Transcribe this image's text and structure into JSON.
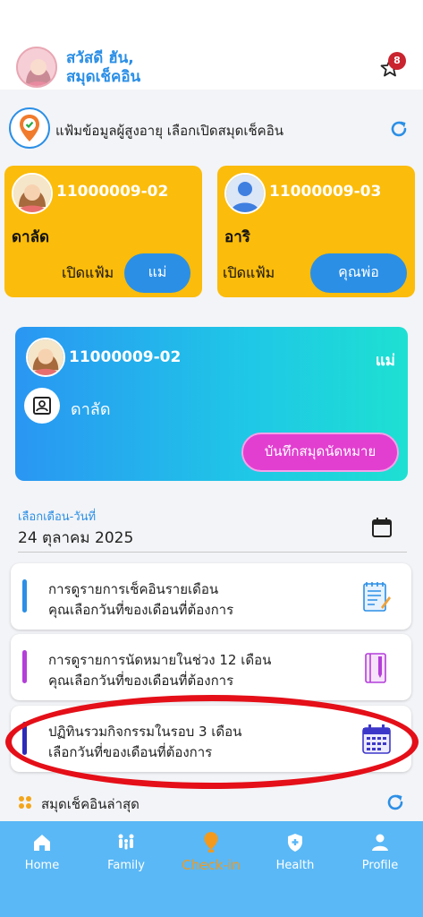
{
  "header": {
    "greeting_line1": "สวัสดี ฮัน,",
    "greeting_line2": "สมุดเช็คอิน",
    "notification_count": "8",
    "avatar_icon": "female-avatar"
  },
  "elderly_section": {
    "title": "แฟ้มข้อมูลผู้สูงอายุ เลือกเปิดสมุดเช็คอิน",
    "location_icon": "location-check-icon",
    "refresh_icon": "refresh-icon"
  },
  "cards": [
    {
      "id": "11000009-02",
      "name": "ดาลัด",
      "open_label": "เปิดแฟ้ม",
      "role": "แม่",
      "avatar": "female-avatar"
    },
    {
      "id": "11000009-03",
      "name": "อาริ",
      "open_label": "เปิดแฟ้ม",
      "role": "คุณพ่อ",
      "avatar": "default-user-avatar"
    }
  ],
  "selected": {
    "id": "11000009-02",
    "role": "แม่",
    "name": "ดาลัด",
    "appointment_button": "บันทึกสมุดนัดหมาย"
  },
  "date": {
    "label": "เลือกเดือน-วันที่",
    "value": "24 ตุลาคม 2025",
    "icon": "calendar-icon"
  },
  "menu_items": [
    {
      "line1": "การดูรายการเช็คอินรายเดือน",
      "line2": "คุณเลือกวันที่ของเดือนที่ต้องการ",
      "bar_color": "#2b8fe6",
      "icon": "checklist-icon"
    },
    {
      "line1": "การดูรายการนัดหมายในช่วง 12 เดือน",
      "line2": "คุณเลือกวันที่ของเดือนที่ต้องการ",
      "bar_color": "#b43ed9",
      "icon": "notebook-icon"
    },
    {
      "line1": "ปฏิทินรวมกิจกรรมในรอบ 3 เดือน",
      "line2": "เลือกวันที่ของเดือนที่ต้องการ",
      "bar_color": "#2d2bb8",
      "icon": "calendar-grid-icon"
    }
  ],
  "latest": {
    "title": "สมุดเช็คอินล่าสุด",
    "icon": "dots-grid-icon"
  },
  "nav": {
    "items": [
      {
        "label": "Home",
        "icon": "home-icon"
      },
      {
        "label": "Family",
        "icon": "family-icon"
      },
      {
        "label": "Check-in",
        "icon": "checkin-pin-icon"
      },
      {
        "label": "Health",
        "icon": "health-shield-icon"
      },
      {
        "label": "Profile",
        "icon": "profile-icon"
      }
    ],
    "active": "Check-in"
  },
  "colors": {
    "accent": "#2b8fe6",
    "card_yellow": "#fbbc0b",
    "appointment_pink": "#e23fd0",
    "nav_bg": "#5ab8f6",
    "nav_active": "#f29a1e",
    "annotation_red": "#e40f18"
  }
}
